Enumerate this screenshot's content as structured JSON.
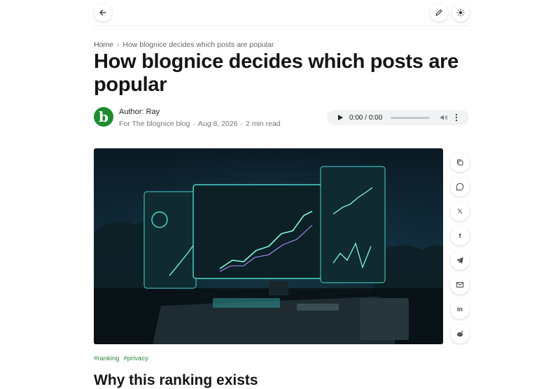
{
  "toolbar": {
    "back_icon": "arrow-left-icon",
    "edit_icon": "pencil-icon",
    "theme_icon": "sun-icon"
  },
  "breadcrumb": {
    "home": "Home",
    "separator": "›",
    "current": "How blognice decides which posts are popular"
  },
  "article": {
    "title": "How blognice decides which posts are popular",
    "author_logo_letter": "b",
    "author_label": "Author: Ray",
    "blog": "For The blognice blog",
    "dot1": "·",
    "date": "Aug 8, 2026",
    "dot2": "·",
    "read_time": "2 min read",
    "hero_image": "futuristic analytics dashboard with line charts"
  },
  "audio_player": {
    "time": "0:00 / 0:00",
    "progress": 0
  },
  "share": {
    "linkedin_label": "in",
    "facebook_label": "f",
    "x_label": "𝕏",
    "icons": [
      "copy-link-icon",
      "whatsapp-icon",
      "x-icon",
      "facebook-icon",
      "telegram-icon",
      "email-icon",
      "linkedin-icon",
      "reddit-icon"
    ]
  },
  "tags": [
    "#ranking",
    "#privacy"
  ],
  "section": {
    "heading": "Why this ranking exists"
  },
  "colors": {
    "brand_green": "#1f8d2e",
    "tag_green": "#2e8b3e"
  }
}
